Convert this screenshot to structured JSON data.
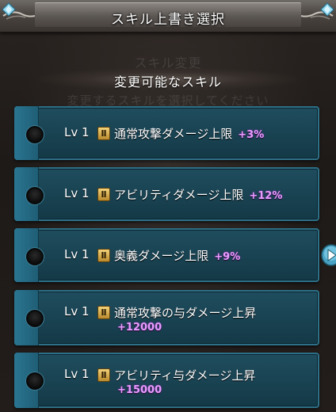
{
  "header": {
    "title": "スキル上書き選択"
  },
  "background": {
    "ghost_lines": [
      "スキル変更",
      "変更するスキルを選択してください"
    ]
  },
  "section": {
    "title": "変更可能なスキル"
  },
  "skills": [
    {
      "level": "Lv 1",
      "rank": "Ⅱ",
      "name": "通常攻撃ダメージ上限",
      "bonus": "+3%"
    },
    {
      "level": "Lv 1",
      "rank": "Ⅱ",
      "name": "アビリティダメージ上限",
      "bonus": "+12%"
    },
    {
      "level": "Lv 1",
      "rank": "Ⅱ",
      "name": "奥義ダメージ上限",
      "bonus": "+9%"
    },
    {
      "level": "Lv 1",
      "rank": "Ⅱ",
      "name": "通常攻撃の与ダメージ上昇",
      "bonus": "+12000"
    },
    {
      "level": "Lv 1",
      "rank": "Ⅱ",
      "name": "アビリティ与ダメージ上昇",
      "bonus": "+15000"
    }
  ],
  "colors": {
    "card_fill": "#1a4454",
    "card_border": "#2d6f86",
    "bonus_text": "#e79cff",
    "rank_badge": "#d9b150"
  },
  "icons": {
    "radio": "radio-empty-icon",
    "rank": "rank-badge-icon",
    "next": "chevron-right-icon",
    "gem": "diamond-gem-icon"
  }
}
